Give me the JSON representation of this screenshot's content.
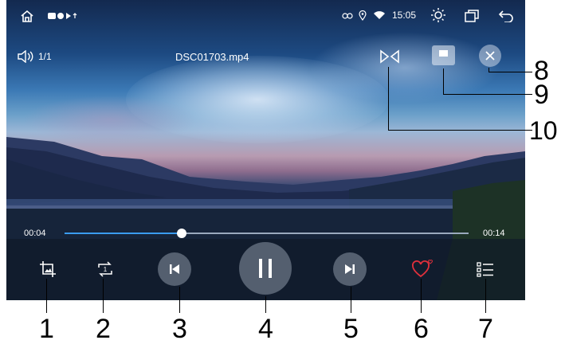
{
  "status_bar": {
    "time": "15:05",
    "icons": [
      "home-icon",
      "media-icon",
      "bluetooth-icon",
      "signal-icon",
      "usb-icon",
      "link-icon",
      "location-icon",
      "wifi-icon",
      "brightness-icon",
      "window-icon",
      "back-icon"
    ]
  },
  "player": {
    "track_counter": "1/1",
    "filename": "DSC01703.mp4",
    "current_time": "00:04",
    "total_time": "00:14",
    "progress": 0.29,
    "accent": "#3a9cf0"
  },
  "controls": [
    {
      "name": "crop-icon"
    },
    {
      "name": "repeat-one-icon"
    },
    {
      "name": "previous-icon"
    },
    {
      "name": "pause-icon"
    },
    {
      "name": "next-icon"
    },
    {
      "name": "favorite-icon",
      "color": "#e0303c"
    },
    {
      "name": "playlist-icon"
    }
  ],
  "top_controls": [
    {
      "name": "mirror-icon"
    },
    {
      "name": "window-mode-icon"
    },
    {
      "name": "close-icon"
    }
  ],
  "callouts": {
    "c1": "1",
    "c2": "2",
    "c3": "3",
    "c4": "4",
    "c5": "5",
    "c6": "6",
    "c7": "7",
    "c8": "8",
    "c9": "9",
    "c10": "10"
  }
}
